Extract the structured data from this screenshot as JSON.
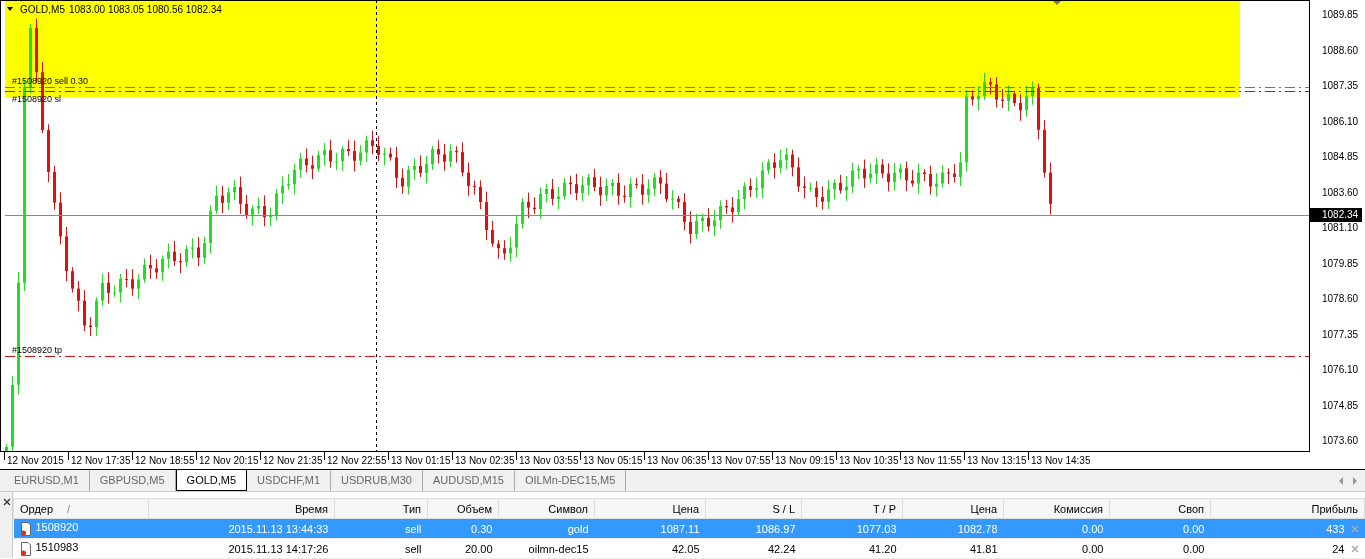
{
  "chart": {
    "title": "GOLD,M5",
    "ohlc": "1083.00 1083.05 1080.56 1082.34",
    "trade_labels": [
      {
        "kind": "entry",
        "text": "#1508920 sell 0.30"
      },
      {
        "kind": "sl",
        "text": "#1508920 sl"
      },
      {
        "kind": "tp",
        "text": "#1508920 tp"
      }
    ],
    "price_labels": [
      "1089.85",
      "1088.60",
      "1087.35",
      "1086.10",
      "1084.85",
      "1083.60",
      "1081.10",
      "1079.85",
      "1078.60",
      "1077.35",
      "1076.10",
      "1074.85",
      "1073.60"
    ],
    "current_price": "1082.34",
    "time_labels": [
      "12 Nov 2015",
      "12 Nov 17:35",
      "12 Nov 18:55",
      "12 Nov 20:15",
      "12 Nov 21:35",
      "12 Nov 22:55",
      "13 Nov 01:15",
      "13 Nov 02:35",
      "13 Nov 03:55",
      "13 Nov 05:15",
      "13 Nov 06:35",
      "13 Nov 07:55",
      "13 Nov 09:15",
      "13 Nov 10:35",
      "13 Nov 11:55",
      "13 Nov 13:15",
      "13 Nov 14:35"
    ]
  },
  "tabs": [
    {
      "label": "EURUSD,M1",
      "selected": false
    },
    {
      "label": "GBPUSD,M5",
      "selected": false
    },
    {
      "label": "GOLD,M5",
      "selected": true
    },
    {
      "label": "USDCHF,M1",
      "selected": false
    },
    {
      "label": "USDRUB,M30",
      "selected": false
    },
    {
      "label": "AUDUSD,M15",
      "selected": false
    },
    {
      "label": "OILMn-DEC15,M5",
      "selected": false
    }
  ],
  "table": {
    "columns": [
      "Ордер",
      "Время",
      "Тип",
      "Объем",
      "Символ",
      "Цена",
      "S / L",
      "T / P",
      "Цена",
      "Комиссия",
      "Своп",
      "Прибыль"
    ],
    "sort_mark": "/",
    "rows": [
      {
        "selected": true,
        "cells": [
          "1508920",
          "2015.11.13 13:44:33",
          "sell",
          "0.30",
          "gold",
          "1087.11",
          "1086.97",
          "1077.03",
          "1082.78",
          "0.00",
          "0.00",
          "433"
        ]
      },
      {
        "selected": false,
        "cells": [
          "1510983",
          "2015.11.13 14:17:26",
          "sell",
          "20.00",
          "oilmn-dec15",
          "42.05",
          "42.24",
          "41.20",
          "41.81",
          "0.00",
          "0.00",
          "24"
        ]
      }
    ]
  }
}
